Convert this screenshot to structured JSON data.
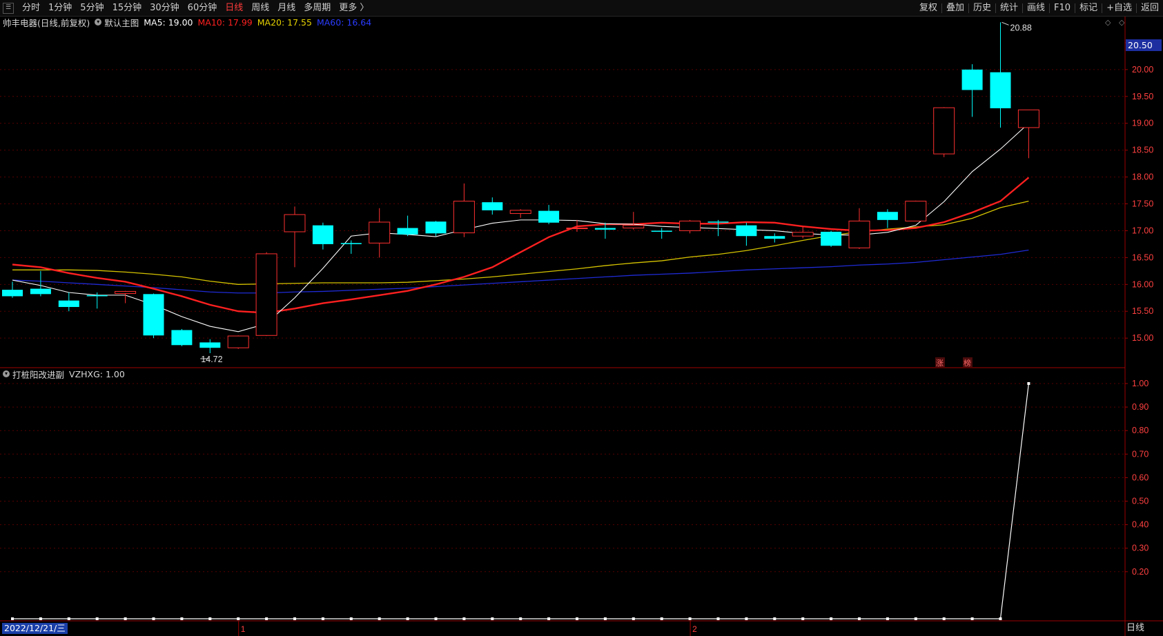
{
  "toolbar": {
    "left_items": [
      "分时",
      "1分钟",
      "5分钟",
      "15分钟",
      "30分钟",
      "60分钟",
      "日线",
      "周线",
      "月线",
      "多周期",
      "更多 〉"
    ],
    "active": "日线",
    "right_items": [
      "复权",
      "叠加",
      "历史",
      "统计",
      "画线",
      "F10",
      "标记",
      "+自选",
      "返回"
    ]
  },
  "main": {
    "title": "帅丰电器(日线,前复权)",
    "indicator": "默认主图",
    "ma5": {
      "label": "MA5: 19.00",
      "color": "#ffffff"
    },
    "ma10": {
      "label": "MA10: 17.99",
      "color": "#ff2020"
    },
    "ma20": {
      "label": "MA20: 17.55",
      "color": "#e6d200"
    },
    "ma60": {
      "label": "MA60: 16.64",
      "color": "#1f2bd6"
    },
    "current_price": "20.50",
    "high_label": "20.88",
    "low_label": "14.72",
    "markers": [
      "涨",
      "榜"
    ],
    "yticks": [
      "15.00",
      "15.50",
      "16.00",
      "16.50",
      "17.00",
      "17.50",
      "18.00",
      "18.50",
      "19.00",
      "19.50",
      "20.00",
      "20.50"
    ]
  },
  "sub": {
    "title": "打桩阳改进副",
    "value": "VZHXG: 1.00",
    "yticks": [
      "0.20",
      "0.30",
      "0.40",
      "0.50",
      "0.60",
      "0.70",
      "0.80",
      "0.90",
      "1.00"
    ]
  },
  "xaxis": {
    "date": "2022/12/21/三",
    "months": [
      "1",
      "2"
    ],
    "period": "日线"
  },
  "colors": {
    "up": "#ff3030",
    "down": "#00ffff",
    "grid": "#5a0000",
    "axis": "#a00000"
  },
  "chart_data": {
    "type": "candlestick",
    "candles": [
      {
        "o": 15.9,
        "h": 16.05,
        "l": 15.75,
        "c": 15.78
      },
      {
        "o": 15.92,
        "h": 16.25,
        "l": 15.78,
        "c": 15.82
      },
      {
        "o": 15.7,
        "h": 15.85,
        "l": 15.5,
        "c": 15.58
      },
      {
        "o": 15.8,
        "h": 15.85,
        "l": 15.55,
        "c": 15.78
      },
      {
        "o": 15.83,
        "h": 15.88,
        "l": 15.65,
        "c": 15.87
      },
      {
        "o": 15.82,
        "h": 15.83,
        "l": 15.0,
        "c": 15.05
      },
      {
        "o": 15.15,
        "h": 15.17,
        "l": 14.85,
        "c": 14.87
      },
      {
        "o": 14.92,
        "h": 14.98,
        "l": 14.72,
        "c": 14.82
      },
      {
        "o": 14.82,
        "h": 15.05,
        "l": 14.8,
        "c": 15.04
      },
      {
        "o": 15.05,
        "h": 16.6,
        "l": 15.04,
        "c": 16.57
      },
      {
        "o": 16.98,
        "h": 17.45,
        "l": 16.32,
        "c": 17.3
      },
      {
        "o": 17.1,
        "h": 17.15,
        "l": 16.65,
        "c": 16.75
      },
      {
        "o": 16.77,
        "h": 16.82,
        "l": 16.57,
        "c": 16.75
      },
      {
        "o": 16.77,
        "h": 17.42,
        "l": 16.5,
        "c": 17.16
      },
      {
        "o": 17.05,
        "h": 17.28,
        "l": 16.9,
        "c": 16.93
      },
      {
        "o": 17.17,
        "h": 17.18,
        "l": 16.9,
        "c": 16.95
      },
      {
        "o": 16.96,
        "h": 17.88,
        "l": 16.88,
        "c": 17.55
      },
      {
        "o": 17.53,
        "h": 17.62,
        "l": 17.3,
        "c": 17.38
      },
      {
        "o": 17.32,
        "h": 17.4,
        "l": 17.24,
        "c": 17.38
      },
      {
        "o": 17.37,
        "h": 17.48,
        "l": 17.12,
        "c": 17.15
      },
      {
        "o": 17.05,
        "h": 17.2,
        "l": 16.98,
        "c": 17.05
      },
      {
        "o": 17.05,
        "h": 17.15,
        "l": 16.85,
        "c": 17.02
      },
      {
        "o": 17.05,
        "h": 17.35,
        "l": 17.02,
        "c": 17.1
      },
      {
        "o": 17.0,
        "h": 17.05,
        "l": 16.85,
        "c": 16.98
      },
      {
        "o": 17.0,
        "h": 17.2,
        "l": 16.95,
        "c": 17.18
      },
      {
        "o": 17.17,
        "h": 17.2,
        "l": 16.9,
        "c": 17.16
      },
      {
        "o": 17.1,
        "h": 17.15,
        "l": 16.72,
        "c": 16.9
      },
      {
        "o": 16.9,
        "h": 16.95,
        "l": 16.78,
        "c": 16.85
      },
      {
        "o": 16.9,
        "h": 17.08,
        "l": 16.86,
        "c": 16.97
      },
      {
        "o": 16.98,
        "h": 17.0,
        "l": 16.7,
        "c": 16.72
      },
      {
        "o": 16.68,
        "h": 17.42,
        "l": 16.66,
        "c": 17.18
      },
      {
        "o": 17.35,
        "h": 17.4,
        "l": 17.05,
        "c": 17.2
      },
      {
        "o": 17.18,
        "h": 17.56,
        "l": 17.18,
        "c": 17.55
      },
      {
        "o": 18.43,
        "h": 19.3,
        "l": 18.37,
        "c": 19.29
      },
      {
        "o": 20.0,
        "h": 20.1,
        "l": 19.12,
        "c": 19.62
      },
      {
        "o": 19.95,
        "h": 20.88,
        "l": 18.92,
        "c": 19.28
      },
      {
        "o": 18.92,
        "h": 19.25,
        "l": 18.35,
        "c": 19.25
      }
    ],
    "ma5": [
      16.08,
      15.98,
      15.85,
      15.8,
      15.8,
      15.62,
      15.4,
      15.22,
      15.12,
      15.27,
      15.75,
      16.3,
      16.9,
      16.96,
      16.93,
      16.89,
      17.02,
      17.14,
      17.2,
      17.2,
      17.19,
      17.13,
      17.12,
      17.08,
      17.06,
      17.04,
      17.02,
      17.0,
      16.95,
      16.92,
      16.92,
      16.97,
      17.1,
      17.54,
      18.1,
      18.52,
      19.0
    ],
    "ma10": [
      16.37,
      16.32,
      16.21,
      16.12,
      16.05,
      15.92,
      15.78,
      15.62,
      15.5,
      15.47,
      15.55,
      15.65,
      15.72,
      15.8,
      15.88,
      16.0,
      16.14,
      16.32,
      16.6,
      16.88,
      17.08,
      17.12,
      17.12,
      17.15,
      17.13,
      17.13,
      17.16,
      17.15,
      17.08,
      17.03,
      17.0,
      17.01,
      17.05,
      17.16,
      17.34,
      17.55,
      17.99
    ],
    "ma20": [
      16.27,
      16.27,
      16.27,
      16.26,
      16.23,
      16.19,
      16.14,
      16.06,
      16.0,
      16.01,
      16.02,
      16.03,
      16.03,
      16.03,
      16.04,
      16.07,
      16.1,
      16.14,
      16.19,
      16.24,
      16.29,
      16.35,
      16.4,
      16.44,
      16.51,
      16.56,
      16.63,
      16.72,
      16.82,
      16.91,
      16.98,
      17.03,
      17.07,
      17.11,
      17.23,
      17.43,
      17.55
    ],
    "ma60": [
      16.08,
      16.06,
      16.03,
      16.0,
      15.97,
      15.94,
      15.9,
      15.86,
      15.84,
      15.84,
      15.86,
      15.87,
      15.89,
      15.91,
      15.93,
      15.96,
      15.99,
      16.02,
      16.05,
      16.08,
      16.11,
      16.14,
      16.17,
      16.19,
      16.21,
      16.24,
      16.27,
      16.29,
      16.31,
      16.33,
      16.36,
      16.38,
      16.41,
      16.46,
      16.51,
      16.56,
      16.64
    ],
    "sub_values": [
      0,
      0,
      0,
      0,
      0,
      0,
      0,
      0,
      0,
      0,
      0,
      0,
      0,
      0,
      0,
      0,
      0,
      0,
      0,
      0,
      0,
      0,
      0,
      0,
      0,
      0,
      0,
      0,
      0,
      0,
      0,
      0,
      0,
      0,
      0,
      0,
      1
    ],
    "main_ylim": [
      14.45,
      21.0
    ],
    "sub_ylim": [
      0,
      1
    ]
  }
}
